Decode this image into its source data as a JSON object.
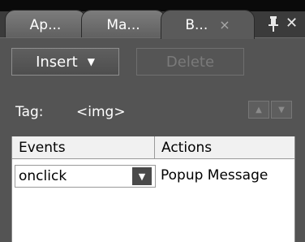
{
  "tabs": [
    {
      "label": "Ap..."
    },
    {
      "label": "Ma..."
    },
    {
      "label": "B...",
      "close": "×"
    }
  ],
  "panel_controls": {
    "pin_icon": "pin-icon",
    "close": "✕"
  },
  "toolbar": {
    "insert_label": "Insert",
    "insert_caret": "▼",
    "delete_label": "Delete"
  },
  "tag": {
    "label": "Tag:",
    "value": "<img>"
  },
  "order": {
    "up": "▲",
    "down": "▼"
  },
  "grid": {
    "headers": {
      "events": "Events",
      "actions": "Actions"
    },
    "rows": [
      {
        "event": "onclick",
        "action": "Popup Message"
      }
    ],
    "dropdown_arrow": "▼"
  }
}
